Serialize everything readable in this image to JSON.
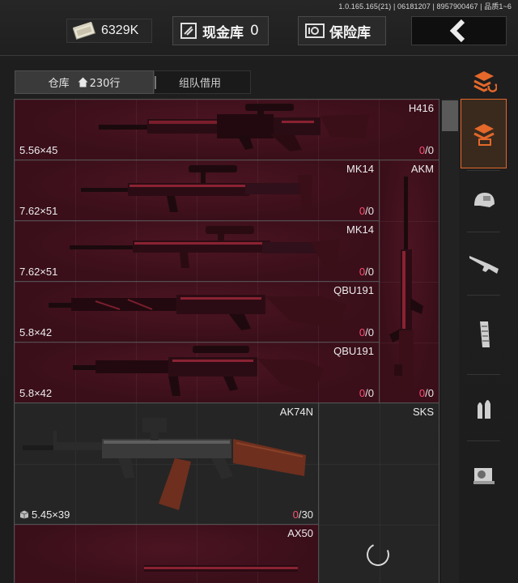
{
  "header": {
    "build_info": "1.0.165.165(21) | 06181207 | 8957900467 | 品质1~6",
    "money": "6329K",
    "cash_vault_label": "现金库",
    "cash_vault_count": "0",
    "safe_label": "保险库"
  },
  "tabs": {
    "warehouse_label": "仓库",
    "warehouse_rows": "230行",
    "team_loan_label": "组队借用"
  },
  "items": [
    {
      "name": "H416",
      "caliber": "5.56×45",
      "ammo_current": "0",
      "ammo_max": "0"
    },
    {
      "name": "MK14",
      "caliber": "7.62×51",
      "ammo_current": "0",
      "ammo_max": "0"
    },
    {
      "name": "AKM",
      "caliber": "",
      "ammo_current": "0",
      "ammo_max": "0"
    },
    {
      "name": "MK14",
      "caliber": "7.62×51",
      "ammo_current": "0",
      "ammo_max": "0"
    },
    {
      "name": "QBU191",
      "caliber": "5.8×42",
      "ammo_current": "0",
      "ammo_max": "0"
    },
    {
      "name": "QBU191",
      "caliber": "5.8×42",
      "ammo_current": "0",
      "ammo_max": "0"
    },
    {
      "name": "AK74N",
      "caliber": "5.45×39",
      "ammo_current": "0",
      "ammo_max": "30"
    },
    {
      "name": "SKS",
      "caliber": "",
      "ammo_current": "",
      "ammo_max": ""
    },
    {
      "name": "AX50",
      "caliber": "",
      "ammo_current": "",
      "ammo_max": ""
    }
  ],
  "sidebar": [
    {
      "icon": "sort-icon"
    },
    {
      "icon": "storage-icon",
      "active": true
    },
    {
      "icon": "helmet-icon"
    },
    {
      "icon": "rifle-icon"
    },
    {
      "icon": "magazine-icon"
    },
    {
      "icon": "ammo-icon"
    },
    {
      "icon": "scope-icon"
    }
  ],
  "colors": {
    "accent": "#e3682a",
    "ammo_current": "#ff4f72",
    "red_cell": "#3a0f1a"
  }
}
